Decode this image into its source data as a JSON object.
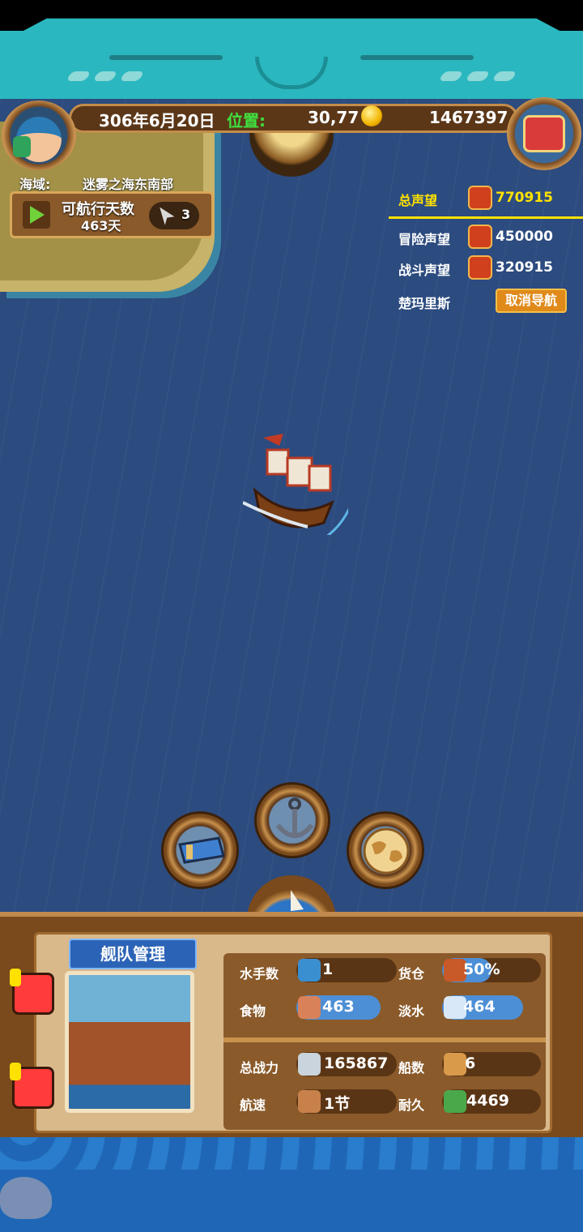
{
  "hud": {
    "date": "306年6月20日",
    "position_label": "位置:",
    "position_value": "30,77",
    "gold": "1467397"
  },
  "location": {
    "sea_area_label": "海域:",
    "sea_area_value": "迷雾之海东南部",
    "sailable_days_label": "可航行天数",
    "sailable_days_value": "463天",
    "cursor_count": "3"
  },
  "reputation": {
    "total_label": "总声望",
    "total_value": "770915",
    "adventure_label": "冒险声望",
    "adventure_value": "450000",
    "battle_label": "战斗声望",
    "battle_value": "320915",
    "destination": "楚玛里斯",
    "cancel_nav": "取消导航"
  },
  "fleet": {
    "tab_label": "舰队管理",
    "sailors_label": "水手数",
    "sailors_value": "1",
    "cargo_label": "货仓",
    "cargo_value": "50%",
    "cargo_fill": 0.5,
    "food_label": "食物",
    "food_value": "463",
    "water_label": "淡水",
    "water_value": "464",
    "power_label": "总战力",
    "power_value": "165867",
    "ships_label": "船数",
    "ships_value": "6",
    "speed_label": "航速",
    "speed_value": "1节",
    "durability_label": "耐久",
    "durability_value": "4469"
  },
  "colors": {
    "frame_teal": "#2bb7bf",
    "sea": "#2c4b7f",
    "wood": "#7a4a1c",
    "accent_yellow": "#ffe200",
    "stat_bar_blue": "#4d8fd6"
  }
}
